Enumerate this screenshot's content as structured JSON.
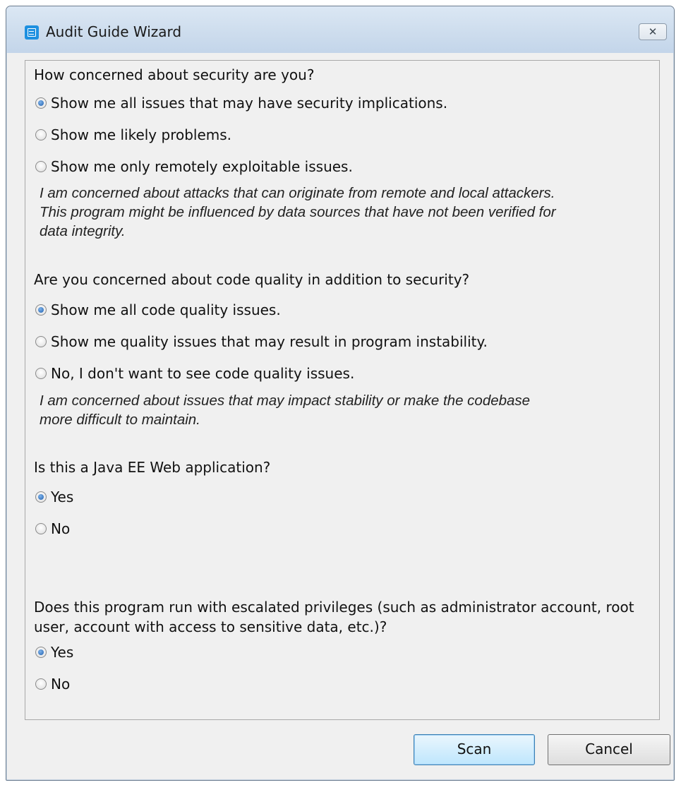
{
  "window": {
    "title": "Audit Guide Wizard",
    "close_symbol": "✕"
  },
  "questions": [
    {
      "question": "How concerned about security are you?",
      "options": [
        {
          "label": "Show me all issues that may have security implications.",
          "selected": true
        },
        {
          "label": "Show me likely problems.",
          "selected": false
        },
        {
          "label": "Show me only remotely exploitable issues.",
          "selected": false
        }
      ],
      "description": [
        "I am concerned about attacks that can originate from remote and local attackers.",
        "This program might be influenced by data sources that have not been verified for",
        "data integrity."
      ]
    },
    {
      "question": "Are you concerned about code quality in addition to security?",
      "options": [
        {
          "label": "Show me all code quality issues.",
          "selected": true
        },
        {
          "label": "Show me quality issues that may result in program instability.",
          "selected": false
        },
        {
          "label": "No, I don't want to see code quality issues.",
          "selected": false
        }
      ],
      "description": [
        "I am concerned about issues that may impact stability or make the codebase",
        "more difficult to maintain."
      ]
    },
    {
      "question": "Is this a Java EE Web application?",
      "options": [
        {
          "label": "Yes",
          "selected": true
        },
        {
          "label": "No",
          "selected": false
        }
      ]
    },
    {
      "question_lines": [
        "Does this program run with escalated privileges (such as administrator account, root",
        "user, account with access to sensitive data, etc.)?"
      ],
      "options": [
        {
          "label": "Yes",
          "selected": true
        },
        {
          "label": "No",
          "selected": false
        }
      ]
    }
  ],
  "buttons": {
    "scan": "Scan",
    "cancel": "Cancel"
  }
}
